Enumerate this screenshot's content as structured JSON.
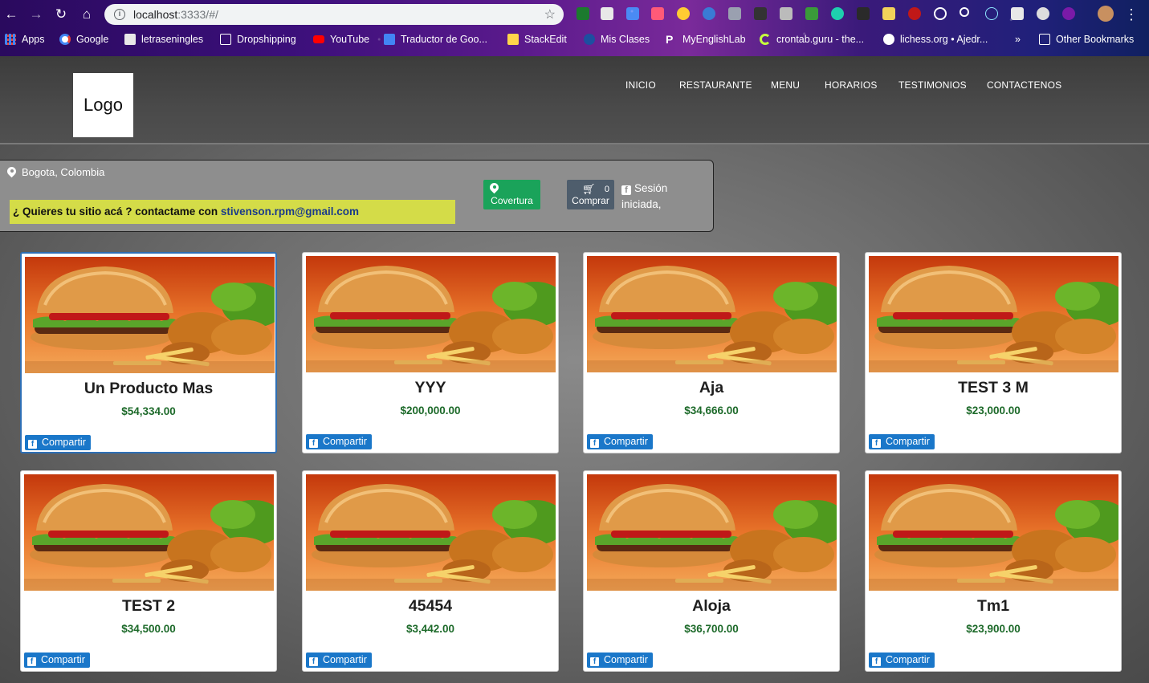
{
  "browser": {
    "url_host": "localhost",
    "url_rest": ":3333/#/",
    "bookmarks": [
      {
        "label": "Apps",
        "color": "#4285f4"
      },
      {
        "label": "Google",
        "color": "#ffffff"
      },
      {
        "label": "letraseningles",
        "color": "#e8e8e8"
      },
      {
        "label": "Dropshipping",
        "color": "#ffffff"
      },
      {
        "label": "YouTube",
        "color": "#ff0000"
      },
      {
        "label": "Traductor de Goo...",
        "color": "#4285f4"
      },
      {
        "label": "StackEdit",
        "color": "#ffd54a"
      },
      {
        "label": "Mis Clases",
        "color": "#1d4fa0"
      },
      {
        "label": "MyEnglishLab",
        "color": "#ffffff"
      },
      {
        "label": "crontab.guru - the...",
        "color": "#c6ff3d"
      },
      {
        "label": "lichess.org • Ajedr...",
        "color": "#ffffff"
      },
      {
        "label": "»",
        "color": ""
      },
      {
        "label": "Other Bookmarks",
        "color": "#ffffff"
      }
    ]
  },
  "site": {
    "logo": "Logo",
    "nav": [
      "INICIO",
      "RESTAURANTE",
      "MENU",
      "HORARIOS",
      "TESTIMONIOS",
      "CONTACTENOS"
    ]
  },
  "infobar": {
    "location": "Bogota, Colombia",
    "promo_text": "¿ Quieres tu sitio acá ? contactame con ",
    "promo_email": "stivenson.rpm@gmail.com",
    "coverage_label": "Covertura",
    "cart_count": "0",
    "cart_label": "Comprar",
    "session_text": "Sesión iniciada,"
  },
  "products": [
    {
      "name": "Un Producto Mas",
      "price": "$54,334.00",
      "share": "Compartir"
    },
    {
      "name": "YYY",
      "price": "$200,000.00",
      "share": "Compartir"
    },
    {
      "name": "Aja",
      "price": "$34,666.00",
      "share": "Compartir"
    },
    {
      "name": "TEST 3 M",
      "price": "$23,000.00",
      "share": "Compartir"
    },
    {
      "name": "TEST 2",
      "price": "$34,500.00",
      "share": "Compartir"
    },
    {
      "name": "45454",
      "price": "$3,442.00",
      "share": "Compartir"
    },
    {
      "name": "Aloja",
      "price": "$36,700.00",
      "share": "Compartir"
    },
    {
      "name": "Tm1",
      "price": "$23,900.00",
      "share": "Compartir"
    }
  ],
  "colors": {
    "promo_bg": "#d4dc48",
    "coverage_btn": "#1aa35a",
    "cart_btn": "#4e5d6c",
    "share_btn": "#1a77c9",
    "price": "#1d6a2a"
  }
}
